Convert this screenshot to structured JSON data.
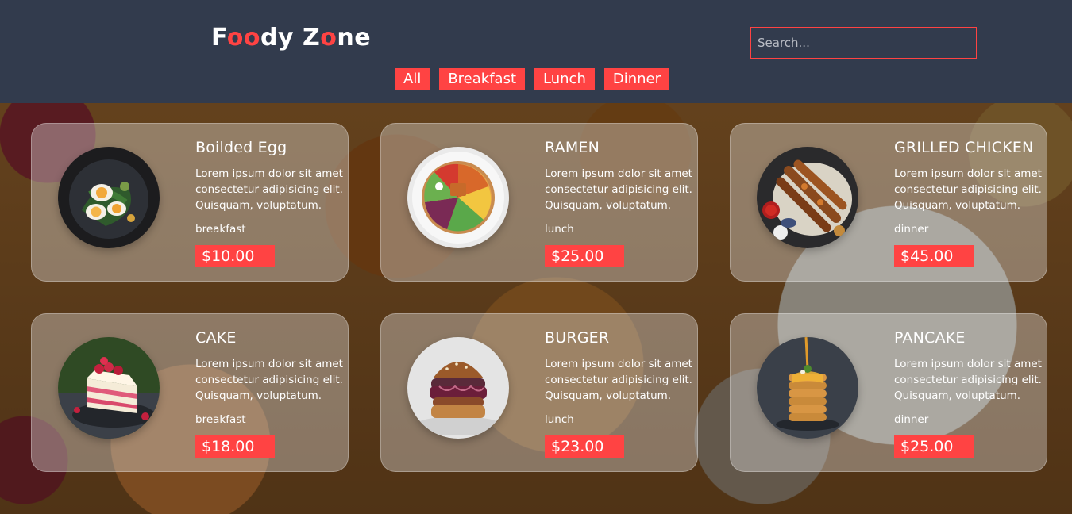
{
  "header": {
    "brand": {
      "part1": "F",
      "part2": "oo",
      "part3": "dy Z",
      "part4": "o",
      "part5": "ne"
    },
    "search": {
      "placeholder": "Search..."
    },
    "filters": [
      "All",
      "Breakfast",
      "Lunch",
      "Dinner"
    ]
  },
  "colors": {
    "accent": "#ff4343",
    "header_bg": "#323b4d",
    "text": "#ffffff"
  },
  "foods": [
    {
      "name": "Boilded Egg",
      "text": "Lorem ipsum dolor sit amet consectetur adipisicing elit. Quisquam, voluptatum.",
      "type": "breakfast",
      "price": "$10.00",
      "image": "boiled-egg-photo"
    },
    {
      "name": "RAMEN",
      "text": "Lorem ipsum dolor sit amet consectetur adipisicing elit. Quisquam, voluptatum.",
      "type": "lunch",
      "price": "$25.00",
      "image": "ramen-bowl-photo"
    },
    {
      "name": "GRILLED CHICKEN",
      "text": "Lorem ipsum dolor sit amet consectetur adipisicing elit. Quisquam, voluptatum.",
      "type": "dinner",
      "price": "$45.00",
      "image": "grilled-chicken-photo"
    },
    {
      "name": "CAKE",
      "text": "Lorem ipsum dolor sit amet consectetur adipisicing elit. Quisquam, voluptatum.",
      "type": "breakfast",
      "price": "$18.00",
      "image": "cake-slice-photo"
    },
    {
      "name": "BURGER",
      "text": "Lorem ipsum dolor sit amet consectetur adipisicing elit. Quisquam, voluptatum.",
      "type": "lunch",
      "price": "$23.00",
      "image": "burger-photo"
    },
    {
      "name": "PANCAKE",
      "text": "Lorem ipsum dolor sit amet consectetur adipisicing elit. Quisquam, voluptatum.",
      "type": "dinner",
      "price": "$25.00",
      "image": "pancake-stack-photo"
    }
  ]
}
